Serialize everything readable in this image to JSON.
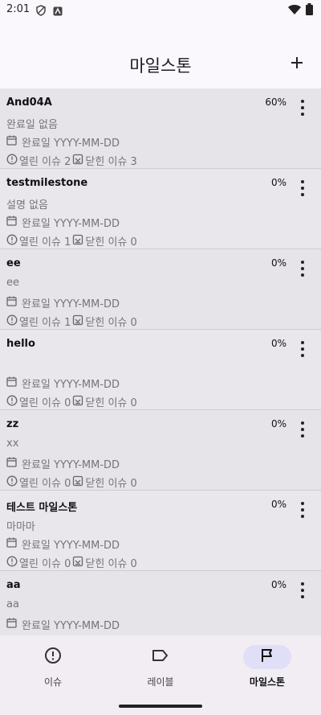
{
  "status_bar": {
    "time": "2:01"
  },
  "app_bar": {
    "title": "마일스톤",
    "add_icon": "plus-icon"
  },
  "milestones": [
    {
      "name": "And04A",
      "description": "완료일 없음",
      "due": "완료일 YYYY-MM-DD",
      "open_issues": "열린 이슈 2",
      "closed_issues": "닫힌 이슈 3",
      "progress": "60%"
    },
    {
      "name": "testmilestone",
      "description": "설명 없음",
      "due": "완료일 YYYY-MM-DD",
      "open_issues": "열린 이슈 1",
      "closed_issues": "닫힌 이슈 0",
      "progress": "0%"
    },
    {
      "name": "ee",
      "description": "ee",
      "due": "완료일 YYYY-MM-DD",
      "open_issues": "열린 이슈 1",
      "closed_issues": "닫힌 이슈 0",
      "progress": "0%"
    },
    {
      "name": "hello",
      "description": "",
      "due": "완료일 YYYY-MM-DD",
      "open_issues": "열린 이슈 0",
      "closed_issues": "닫힌 이슈 0",
      "progress": "0%"
    },
    {
      "name": "zz",
      "description": "xx",
      "due": "완료일 YYYY-MM-DD",
      "open_issues": "열린 이슈 0",
      "closed_issues": "닫힌 이슈 0",
      "progress": "0%"
    },
    {
      "name": "테스트 마일스톤",
      "description": "마마마",
      "due": "완료일 YYYY-MM-DD",
      "open_issues": "열린 이슈 0",
      "closed_issues": "닫힌 이슈 0",
      "progress": "0%"
    },
    {
      "name": "aa",
      "description": "aa",
      "due": "완료일 YYYY-MM-DD",
      "open_issues": "",
      "closed_issues": "",
      "progress": "0%"
    }
  ],
  "bottom_nav": [
    {
      "label": "이슈",
      "icon": "alert-circle-icon",
      "active": false
    },
    {
      "label": "레이블",
      "icon": "label-tag-icon",
      "active": false
    },
    {
      "label": "마일스톤",
      "icon": "flag-icon",
      "active": true
    }
  ],
  "colors": {
    "background": "#fbf8fd",
    "active_nav": "#e1dff7",
    "list_bg": "#e7e4ea"
  }
}
